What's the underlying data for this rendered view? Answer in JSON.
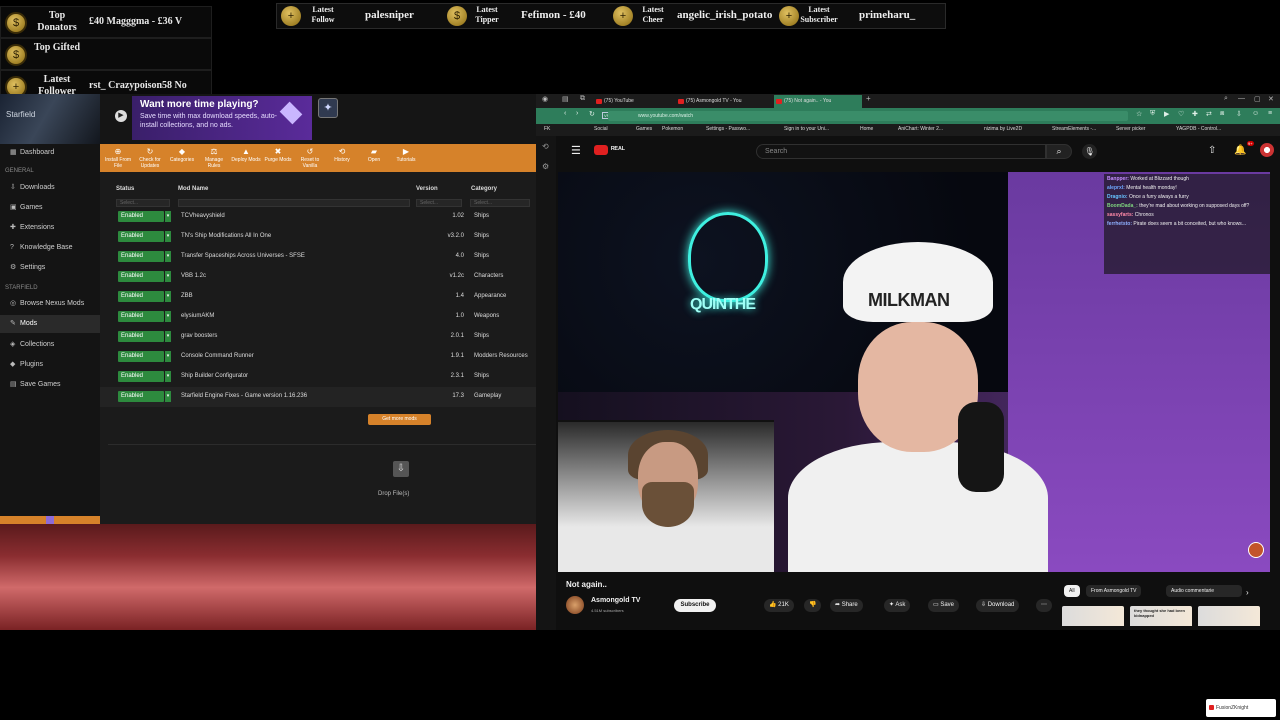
{
  "overlay": {
    "top_donators": {
      "title": "Top Donators",
      "value": "£40   Magggma - £36   V"
    },
    "top_gifted": {
      "title": "Top Gifted",
      "value": ""
    },
    "latest_follower": {
      "title": "Latest Follower",
      "value": "rst_   Crazypoison58   No"
    },
    "strip": [
      {
        "title": "Latest Follow",
        "value": "palesniper"
      },
      {
        "title": "Latest Tipper",
        "value": "Fefimon - £40"
      },
      {
        "title": "Latest Cheer",
        "value": "angelic_irish_potato"
      },
      {
        "title": "Latest Subscriber",
        "value": "primeharu_"
      }
    ]
  },
  "vortex": {
    "game_label": "Starfield",
    "ad_title": "Want more time playing?",
    "ad_text": "Save time with max download speeds, auto-install collections, and no ads.",
    "nav": [
      {
        "label": "Dashboard",
        "icon": "▦"
      },
      {
        "section": "GENERAL"
      },
      {
        "label": "Downloads",
        "icon": "⇩"
      },
      {
        "label": "Games",
        "icon": "▣"
      },
      {
        "label": "Extensions",
        "icon": "✚"
      },
      {
        "label": "Knowledge Base",
        "icon": "?"
      },
      {
        "label": "Settings",
        "icon": "⚙"
      },
      {
        "section": "STARFIELD"
      },
      {
        "label": "Browse Nexus Mods",
        "icon": "◎"
      },
      {
        "label": "Mods",
        "icon": "✎",
        "active": true
      },
      {
        "label": "Collections",
        "icon": "◈"
      },
      {
        "label": "Plugins",
        "icon": "◆"
      },
      {
        "label": "Save Games",
        "icon": "▤"
      }
    ],
    "toolbar": [
      "Install From File",
      "Check for Updates",
      "Categories",
      "Manage Rules",
      "Deploy Mods",
      "Purge Mods",
      "Reset to Vanilla",
      "History",
      "Open",
      "Tutorials"
    ],
    "columns": {
      "status": "Status",
      "name": "Mod Name",
      "version": "Version",
      "category": "Category"
    },
    "filter_placeholder": "Select...",
    "mods": [
      {
        "status": "Enabled",
        "name": "TCVheavyshield",
        "version": "1.02",
        "category": "Ships"
      },
      {
        "status": "Enabled",
        "name": "TN's Ship Modifications All In One",
        "version": "v3.2.0",
        "category": "Ships"
      },
      {
        "status": "Enabled",
        "name": "Transfer Spaceships Across Universes - SFSE",
        "version": "4.0",
        "category": "Ships"
      },
      {
        "status": "Enabled",
        "name": "VBB 1.2c",
        "version": "v1.2c",
        "category": "Characters"
      },
      {
        "status": "Enabled",
        "name": "ZBB",
        "version": "1.4",
        "category": "Appearance"
      },
      {
        "status": "Enabled",
        "name": "elysiumAKM",
        "version": "1.0",
        "category": "Weapons"
      },
      {
        "status": "Enabled",
        "name": "grav boosters",
        "version": "2.0.1",
        "category": "Ships"
      },
      {
        "status": "Enabled",
        "name": "Console Command Runner",
        "version": "1.9.1",
        "category": "Modders Resources"
      },
      {
        "status": "Enabled",
        "name": "Ship Builder Configurator",
        "version": "2.3.1",
        "category": "Ships"
      },
      {
        "status": "Enabled",
        "name": "Starfield Engine Fixes - Game version 1.16.236",
        "version": "17.3",
        "category": "Gameplay"
      }
    ],
    "get_more": "Get more mods",
    "drop": "Drop File(s)"
  },
  "browser": {
    "tabs": [
      "(75) YouTube",
      "(75) Asmongold TV - You",
      "(75) Not again.. - You"
    ],
    "url": "www.youtube.com/watch",
    "vpn": "VPN",
    "bookmarks": [
      "FK",
      "Social",
      "Games",
      "Pokemon",
      "Settings - Passwo...",
      "Sign in to your Uni...",
      "Home",
      "AniChart: Winter 2...",
      "nizima by Live2D",
      "StreamElements -...",
      "Server picker",
      "YAGPDB - Control..."
    ]
  },
  "youtube": {
    "logo_text": "ᴿᴱᴬᴸ",
    "search_placeholder": "Search",
    "notif_count": "9+",
    "neon_text": "QUINTHE",
    "hat_text": "MILKMAN",
    "chat": [
      {
        "user": "Banpper:",
        "msg": "Worked at Blizzard though",
        "color": "#c48cff"
      },
      {
        "user": "aleprxl:",
        "msg": "Mental health monday!",
        "color": "#6fa8ff"
      },
      {
        "user": "Dragnio:",
        "msg": "Once a furry always a furry",
        "color": "#66c2ff"
      },
      {
        "user": "BoomDada_:",
        "msg": "they're mad about working on supposed days off?",
        "color": "#7fd67f"
      },
      {
        "user": "sassyfarts:",
        "msg": "Chronos",
        "color": "#ff8aa8"
      },
      {
        "user": "ferrhetsto:",
        "msg": "Pirate does seem a bit conceited, but who knows...",
        "color": "#8fb0ff"
      }
    ],
    "title": "Not again..",
    "channel": "Asmongold TV",
    "subs": "4.51M subscribers",
    "subscribe": "Subscribe",
    "likes": "21K",
    "share": "Share",
    "ask": "Ask",
    "save": "Save",
    "download": "Download",
    "chips": [
      "All",
      "From Asmongold TV",
      "Audio commentarie"
    ],
    "thumb_text": "they thought she had been kidnapped"
  },
  "watermark": "FusionZKnight"
}
